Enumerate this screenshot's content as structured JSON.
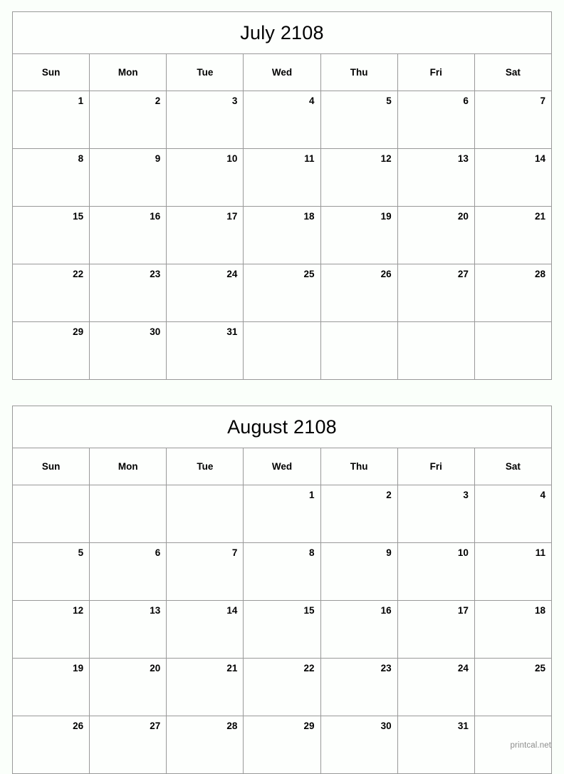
{
  "page": {
    "background_color": "#fafffa",
    "border_color": "#999999",
    "watermark": "printcal.net"
  },
  "calendars": [
    {
      "title": "July 2108",
      "weekdays": [
        "Sun",
        "Mon",
        "Tue",
        "Wed",
        "Thu",
        "Fri",
        "Sat"
      ],
      "weeks": [
        [
          "1",
          "2",
          "3",
          "4",
          "5",
          "6",
          "7"
        ],
        [
          "8",
          "9",
          "10",
          "11",
          "12",
          "13",
          "14"
        ],
        [
          "15",
          "16",
          "17",
          "18",
          "19",
          "20",
          "21"
        ],
        [
          "22",
          "23",
          "24",
          "25",
          "26",
          "27",
          "28"
        ],
        [
          "29",
          "30",
          "31",
          "",
          "",
          "",
          ""
        ]
      ]
    },
    {
      "title": "August 2108",
      "weekdays": [
        "Sun",
        "Mon",
        "Tue",
        "Wed",
        "Thu",
        "Fri",
        "Sat"
      ],
      "weeks": [
        [
          "",
          "",
          "",
          "1",
          "2",
          "3",
          "4"
        ],
        [
          "5",
          "6",
          "7",
          "8",
          "9",
          "10",
          "11"
        ],
        [
          "12",
          "13",
          "14",
          "15",
          "16",
          "17",
          "18"
        ],
        [
          "19",
          "20",
          "21",
          "22",
          "23",
          "24",
          "25"
        ],
        [
          "26",
          "27",
          "28",
          "29",
          "30",
          "31",
          ""
        ]
      ]
    }
  ]
}
